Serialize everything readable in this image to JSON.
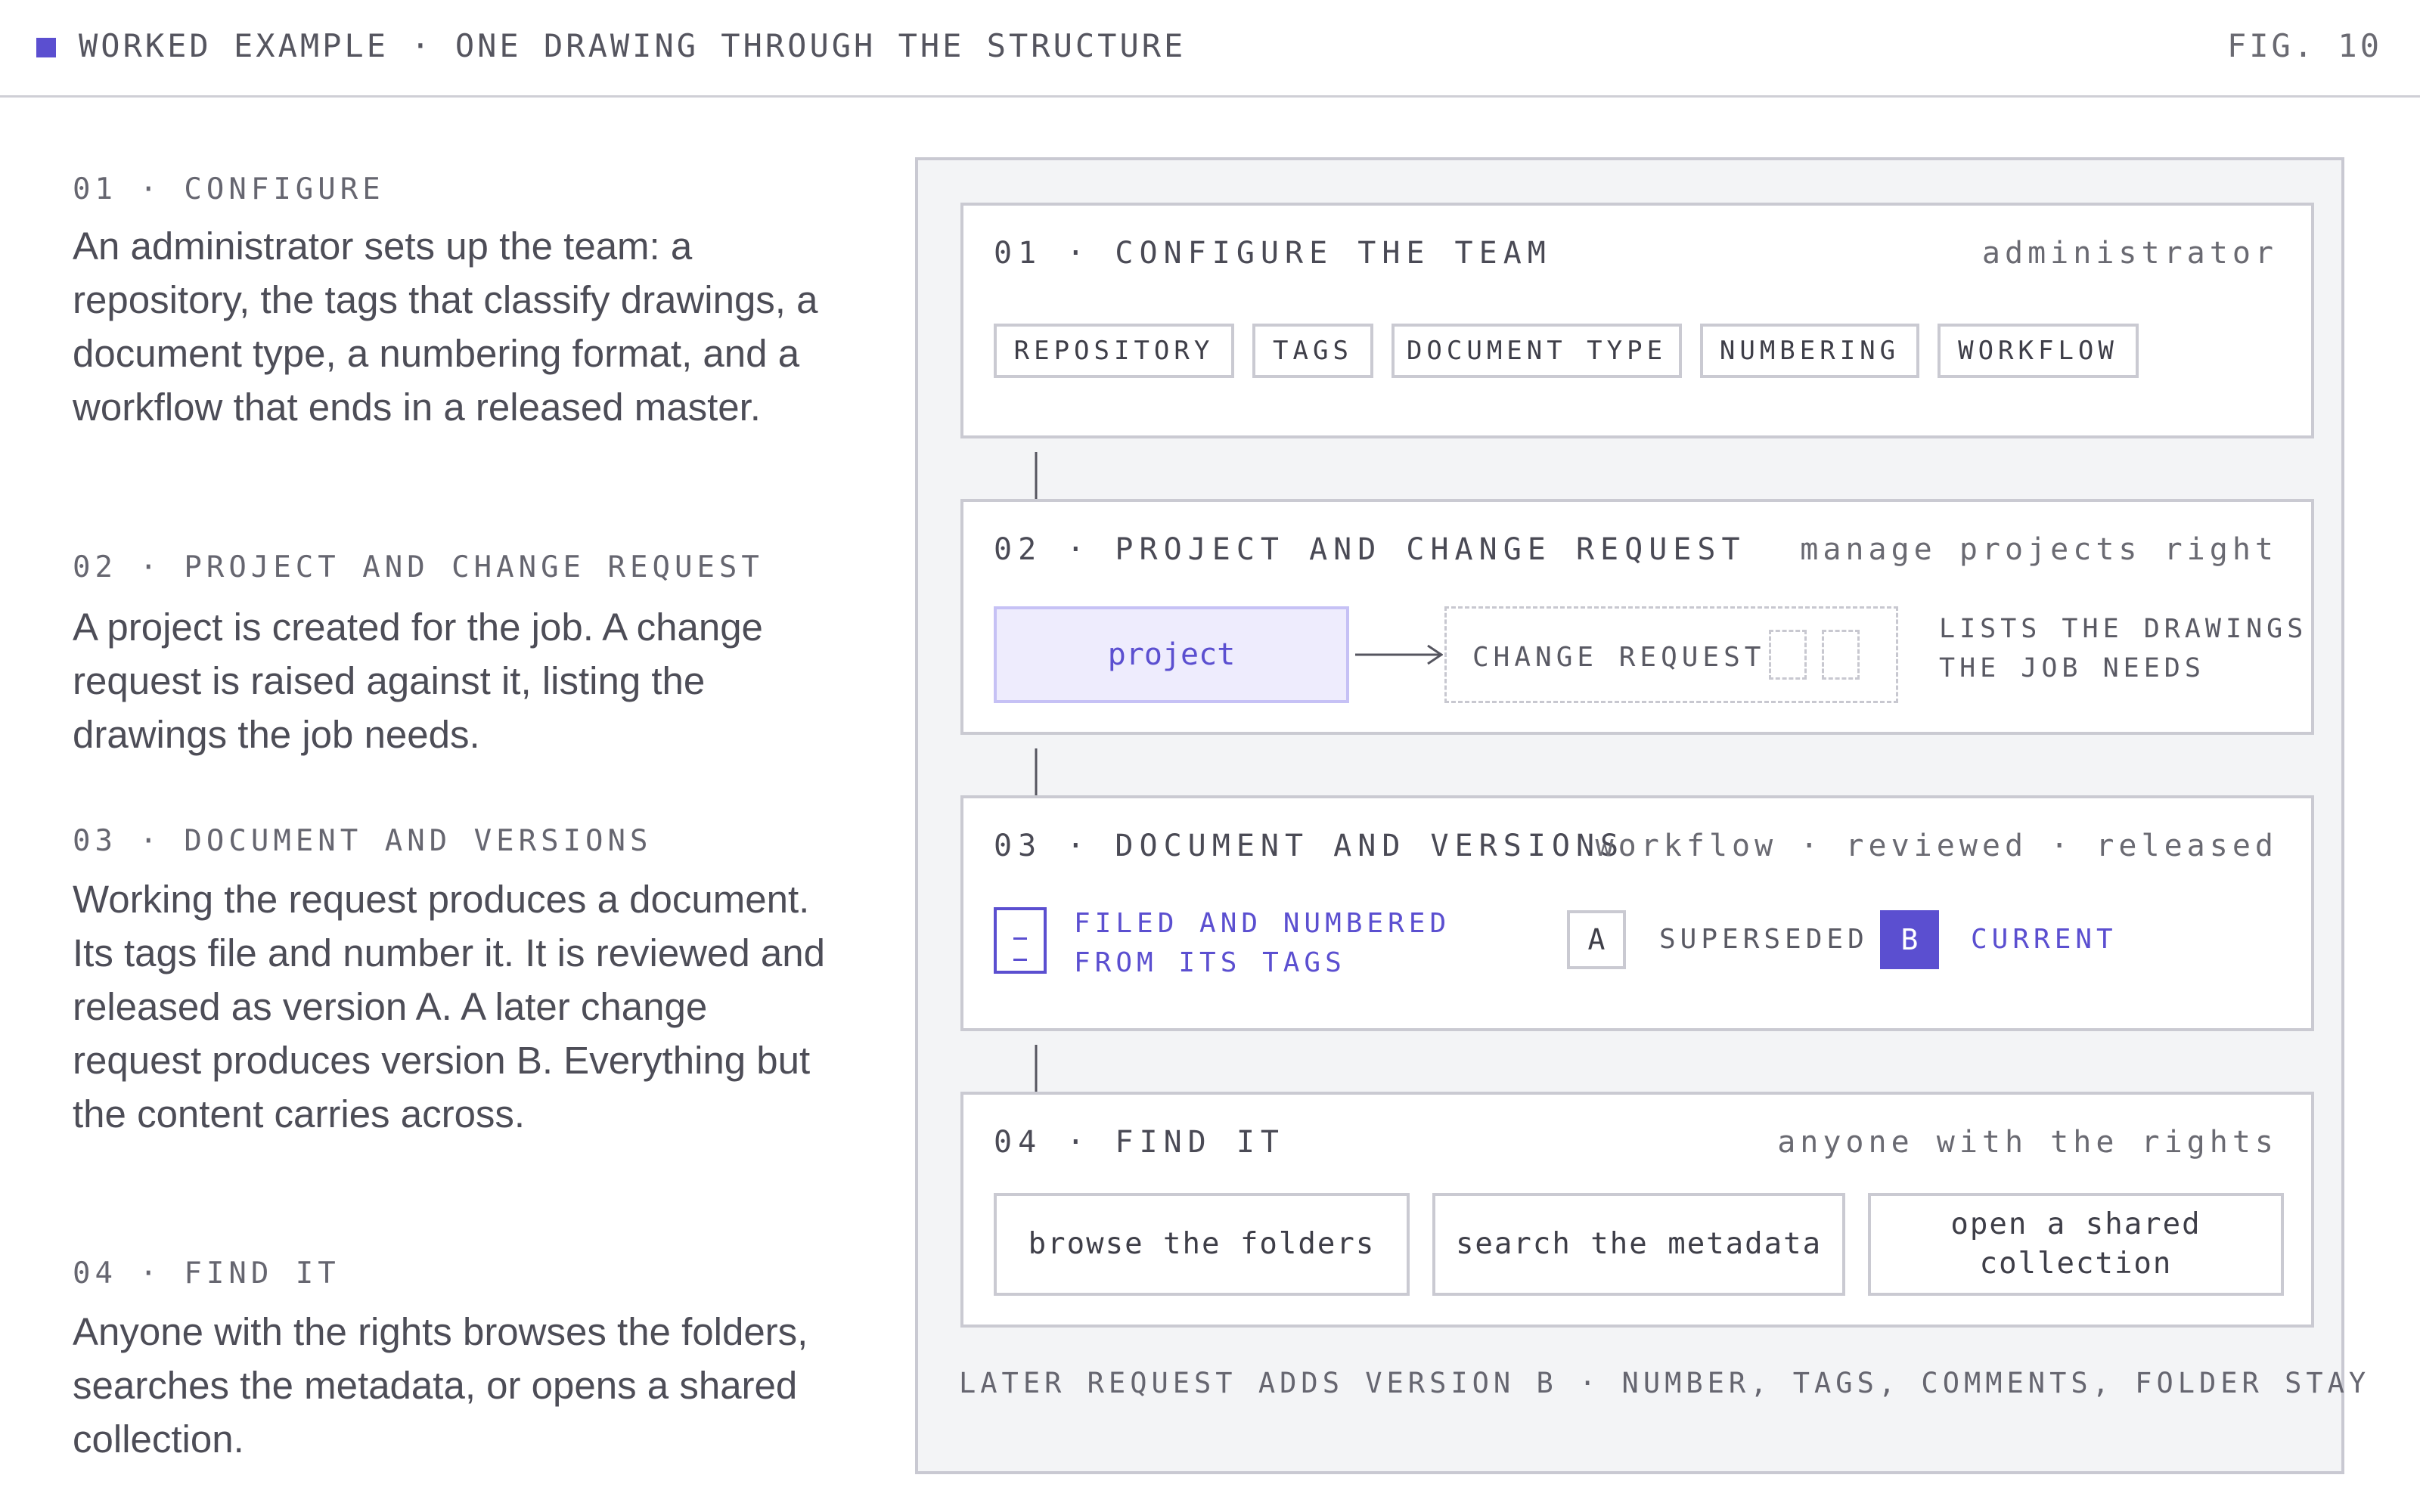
{
  "header": {
    "title": "WORKED EXAMPLE · ONE DRAWING THROUGH THE STRUCTURE",
    "figure": "FIG. 10",
    "accent_color": "#5b4fd0"
  },
  "steps": [
    {
      "label": "01 · CONFIGURE",
      "body": "An administrator sets up the team: a repository, the tags that classify drawings, a document type, a numbering format, and a workflow that ends in a released master."
    },
    {
      "label": "02 · PROJECT AND CHANGE REQUEST",
      "body": "A project is created for the job. A change request is raised against it, listing the drawings the job needs."
    },
    {
      "label": "03 · DOCUMENT AND VERSIONS",
      "body": "Working the request produces a document. Its tags file and number it. It is reviewed and released as version A. A later change request produces version B. Everything but the content carries across."
    },
    {
      "label": "04 · FIND IT",
      "body": "Anyone with the rights browses the folders, searches the metadata, or opens a shared collection."
    }
  ],
  "diagram": {
    "configure": {
      "title": "01 · CONFIGURE THE TEAM",
      "role": "administrator",
      "chips": [
        "REPOSITORY",
        "TAGS",
        "DOCUMENT TYPE",
        "NUMBERING",
        "WORKFLOW"
      ]
    },
    "project": {
      "title": "02 · PROJECT AND CHANGE REQUEST",
      "role": "manage projects right",
      "project_label": "project",
      "change_request_label": "CHANGE REQUEST",
      "note_line1": "LISTS THE DRAWINGS",
      "note_line2": "THE JOB NEEDS"
    },
    "document": {
      "title": "03 · DOCUMENT AND VERSIONS",
      "role": "workflow · reviewed · released",
      "filed_line1": "FILED AND NUMBERED",
      "filed_line2": "FROM ITS TAGS",
      "version_a": "A",
      "version_a_label": "SUPERSEDED",
      "version_b": "B",
      "version_b_label": "CURRENT"
    },
    "find": {
      "title": "04 · FIND IT",
      "role": "anyone with the rights",
      "buttons": [
        "browse the folders",
        "search the metadata",
        "open a shared collection"
      ]
    },
    "footer": "LATER REQUEST ADDS VERSION B · NUMBER, TAGS, COMMENTS, FOLDER STAY"
  }
}
